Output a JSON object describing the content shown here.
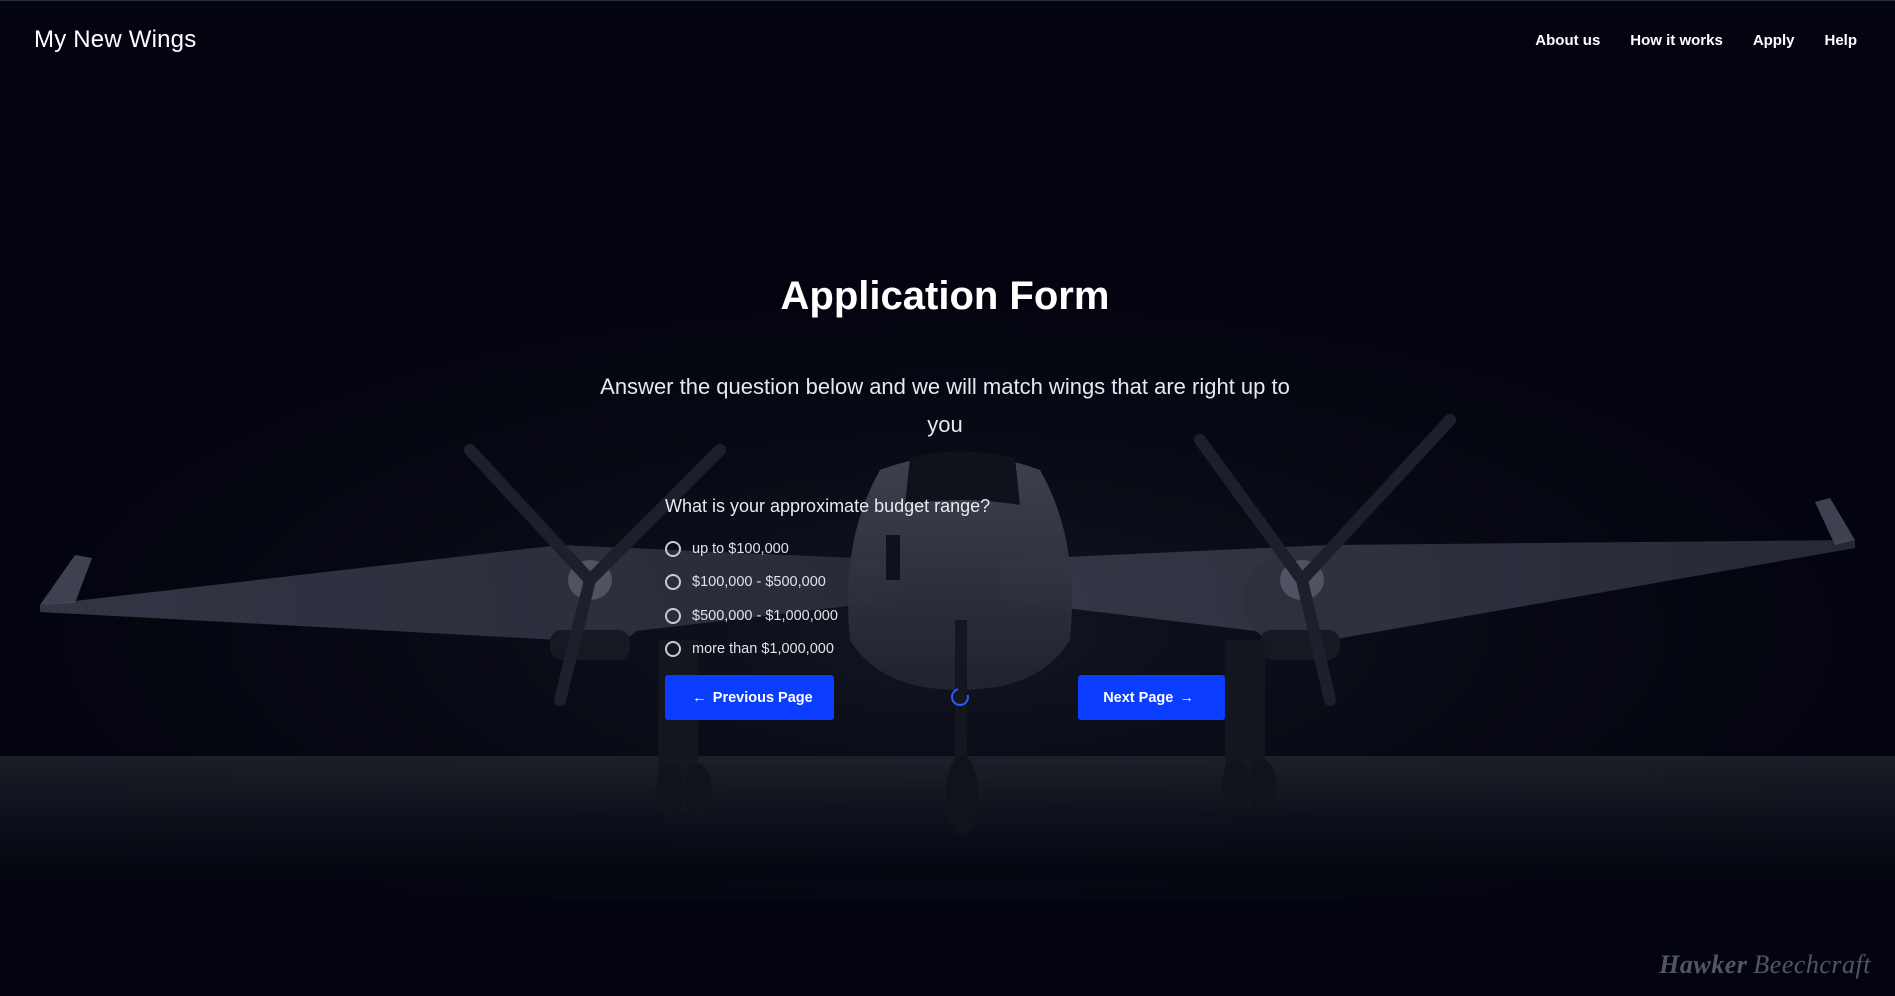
{
  "header": {
    "brand": "My New Wings",
    "nav": [
      "About us",
      "How it works",
      "Apply",
      "Help"
    ]
  },
  "form": {
    "title": "Application Form",
    "subtitle": "Answer the question below and we will match wings that are right up to you",
    "question": "What is your approximate budget range?",
    "options": [
      "up to $100,000",
      "$100,000 - $500,000",
      "$500,000 - $1,000,000",
      "more than $1,000,000"
    ],
    "prev_label": "Previous Page",
    "next_label": "Next Page",
    "prev_arrow": "←",
    "next_arrow": "→"
  },
  "background": {
    "watermark_brand": "Hawker",
    "watermark_model": "Beechcraft"
  },
  "colors": {
    "background": "#03050f",
    "button": "#0a3dff",
    "text": "#ffffff"
  },
  "icons": {
    "loading": "loading-spinner-icon",
    "radio": "radio-unchecked-icon"
  }
}
